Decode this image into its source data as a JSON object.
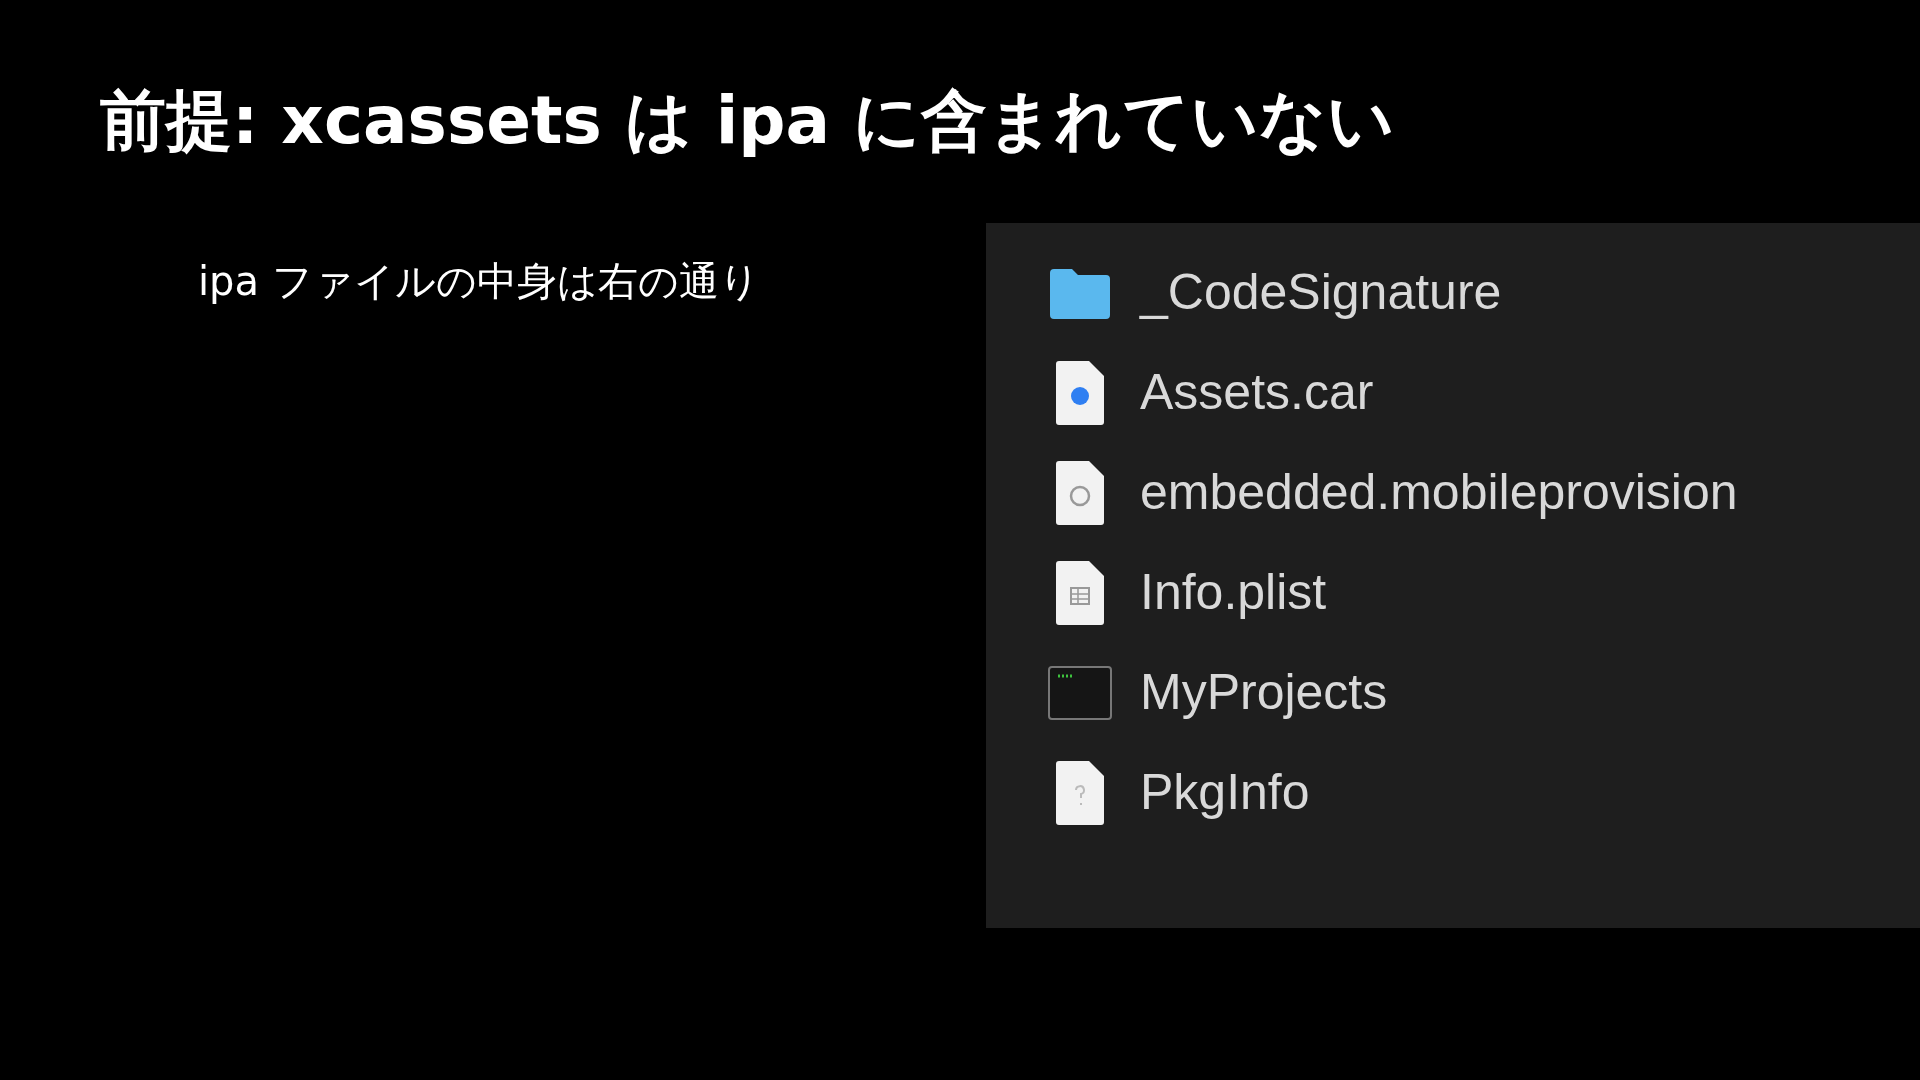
{
  "title": "前提: xcassets は ipa に含まれていない",
  "body": "ipa ファイルの中身は右の通り",
  "files": [
    {
      "name": "_CodeSignature",
      "kind": "folder"
    },
    {
      "name": "Assets.car",
      "kind": "asset"
    },
    {
      "name": "embedded.mobileprovision",
      "kind": "provision"
    },
    {
      "name": "Info.plist",
      "kind": "plist"
    },
    {
      "name": "MyProjects",
      "kind": "exec"
    },
    {
      "name": "PkgInfo",
      "kind": "unknown"
    }
  ]
}
